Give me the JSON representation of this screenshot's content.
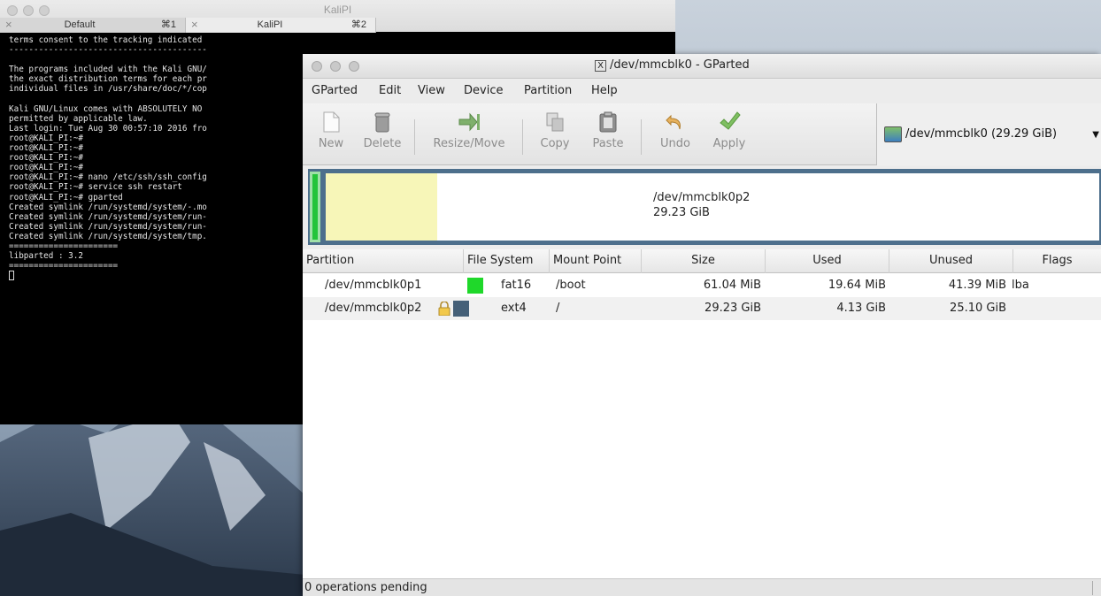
{
  "terminal": {
    "title": "KaliPI",
    "tabs": [
      {
        "name": "Default",
        "shortcut": "⌘1"
      },
      {
        "name": "KaliPI",
        "shortcut": "⌘2"
      }
    ],
    "lines": [
      "terms consent to the tracking indicated",
      "----------------------------------------",
      "",
      "The programs included with the Kali GNU/",
      "the exact distribution terms for each pr",
      "individual files in /usr/share/doc/*/cop",
      "",
      "Kali GNU/Linux comes with ABSOLUTELY NO",
      "permitted by applicable law.",
      "Last login: Tue Aug 30 00:57:10 2016 fro",
      "root@KALI_PI:~#",
      "root@KALI_PI:~#",
      "root@KALI_PI:~#",
      "root@KALI_PI:~#",
      "root@KALI_PI:~# nano /etc/ssh/ssh_config",
      "root@KALI_PI:~# service ssh restart",
      "root@KALI_PI:~# gparted",
      "Created symlink /run/systemd/system/-.mo",
      "Created symlink /run/systemd/system/run-",
      "Created symlink /run/systemd/system/run-",
      "Created symlink /run/systemd/system/tmp.",
      "======================",
      "libparted : 3.2",
      "======================"
    ]
  },
  "gparted": {
    "title": "/dev/mmcblk0 - GParted",
    "menu": [
      "GParted",
      "Edit",
      "View",
      "Device",
      "Partition",
      "Help"
    ],
    "toolbar": {
      "new": "New",
      "delete": "Delete",
      "resize_move": "Resize/Move",
      "copy": "Copy",
      "paste": "Paste",
      "undo": "Undo",
      "apply": "Apply"
    },
    "device": "/dev/mmcblk0  (29.29 GiB)",
    "graph": {
      "partition": "/dev/mmcblk0p2",
      "size": "29.23 GiB"
    },
    "columns": [
      "Partition",
      "File System",
      "Mount Point",
      "Size",
      "Used",
      "Unused",
      "Flags"
    ],
    "rows": [
      {
        "partition": "/dev/mmcblk0p1",
        "fs": "fat16",
        "fs_color": "#1fd82a",
        "mount": "/boot",
        "size": "61.04 MiB",
        "used": "19.64 MiB",
        "unused": "41.39 MiB",
        "flags": "lba",
        "locked": false
      },
      {
        "partition": "/dev/mmcblk0p2",
        "fs": "ext4",
        "fs_color": "#456078",
        "mount": "/",
        "size": "29.23 GiB",
        "used": "4.13 GiB",
        "unused": "25.10 GiB",
        "flags": "",
        "locked": true
      }
    ],
    "status": "0 operations pending"
  }
}
